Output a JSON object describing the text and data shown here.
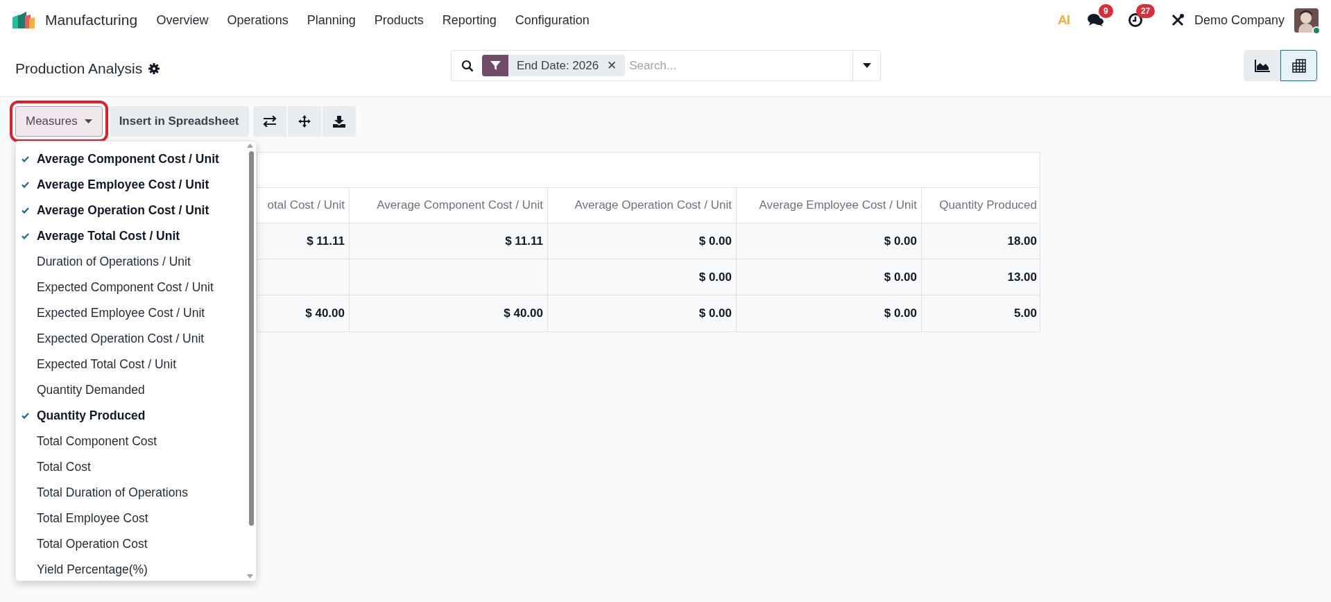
{
  "navbar": {
    "app_name": "Manufacturing",
    "menu": [
      "Overview",
      "Operations",
      "Planning",
      "Products",
      "Reporting",
      "Configuration"
    ],
    "ai_label": "AI",
    "messages_badge": "9",
    "activities_badge": "27",
    "company": "Demo Company"
  },
  "control_panel": {
    "title": "Production Analysis",
    "search": {
      "facet": "End Date: 2026",
      "remove": "✕",
      "placeholder": "Search..."
    },
    "views": [
      {
        "kind": "graph",
        "selected": false
      },
      {
        "kind": "pivot",
        "selected": true
      }
    ]
  },
  "toolbar": {
    "measures_button": "Measures",
    "insert_button": "Insert in Spreadsheet"
  },
  "measures_menu": [
    {
      "label": "Average Component Cost / Unit",
      "checked": true
    },
    {
      "label": "Average Employee Cost / Unit",
      "checked": true
    },
    {
      "label": "Average Operation Cost / Unit",
      "checked": true
    },
    {
      "label": "Average Total Cost / Unit",
      "checked": true
    },
    {
      "label": "Duration of Operations / Unit",
      "checked": false
    },
    {
      "label": "Expected Component Cost / Unit",
      "checked": false
    },
    {
      "label": "Expected Employee Cost / Unit",
      "checked": false
    },
    {
      "label": "Expected Operation Cost / Unit",
      "checked": false
    },
    {
      "label": "Expected Total Cost / Unit",
      "checked": false
    },
    {
      "label": "Quantity Demanded",
      "checked": false
    },
    {
      "label": "Quantity Produced",
      "checked": true
    },
    {
      "label": "Total Component Cost",
      "checked": false
    },
    {
      "label": "Total Cost",
      "checked": false
    },
    {
      "label": "Total Duration of Operations",
      "checked": false
    },
    {
      "label": "Total Employee Cost",
      "checked": false
    },
    {
      "label": "Total Operation Cost",
      "checked": false
    },
    {
      "label": "Yield Percentage(%)",
      "checked": false
    }
  ],
  "pivot": {
    "columns": [
      "otal Cost / Unit",
      "Average Component Cost / Unit",
      "Average Operation Cost / Unit",
      "Average Employee Cost / Unit",
      "Quantity Produced"
    ],
    "rows": [
      [
        "$ 11.11",
        "$ 11.11",
        "$ 0.00",
        "$ 0.00",
        "18.00"
      ],
      [
        "",
        "",
        "$ 0.00",
        "$ 0.00",
        "13.00"
      ],
      [
        "$ 40.00",
        "$ 40.00",
        "$ 0.00",
        "$ 0.00",
        "5.00"
      ]
    ]
  }
}
